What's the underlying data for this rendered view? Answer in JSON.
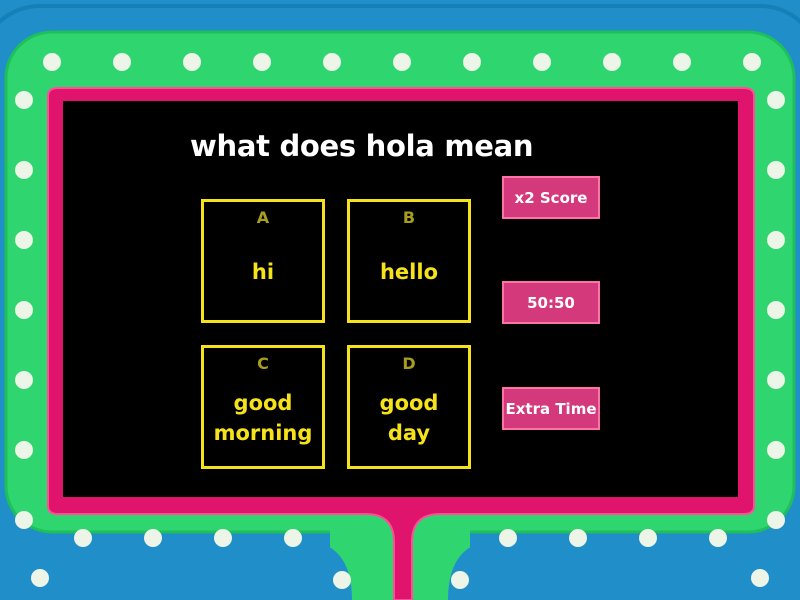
{
  "question": "what does hola mean",
  "answers": [
    {
      "letter": "A",
      "text": "hi"
    },
    {
      "letter": "B",
      "text": "hello"
    },
    {
      "letter": "C",
      "text": "good morning"
    },
    {
      "letter": "D",
      "text": "good day"
    }
  ],
  "powerups": {
    "double_score": "x2 Score",
    "fifty_fifty": "50:50",
    "extra_time": "Extra Time"
  },
  "colors": {
    "background": "#1f8ec9",
    "frame_outer": "#1f8ec9",
    "frame_green": "#2fd66f",
    "frame_inner": "#e0146c",
    "screen": "#000000",
    "answer_yellow": "#f5e21b",
    "powerup_pink": "#d43a7b"
  }
}
